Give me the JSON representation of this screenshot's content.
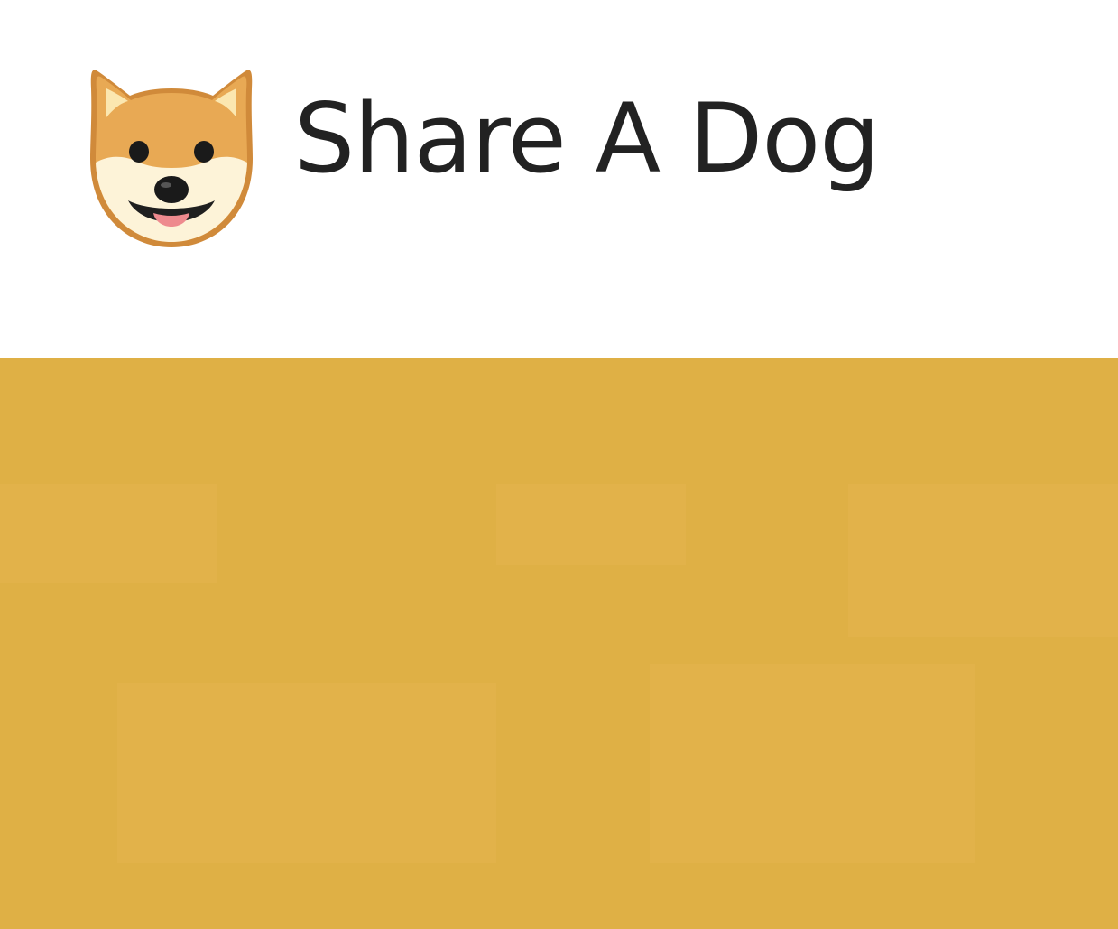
{
  "header": {
    "logo_icon": "shiba-dog-face-icon",
    "title": "Share A Dog"
  },
  "banner": {
    "background_color": "#dfb045"
  }
}
